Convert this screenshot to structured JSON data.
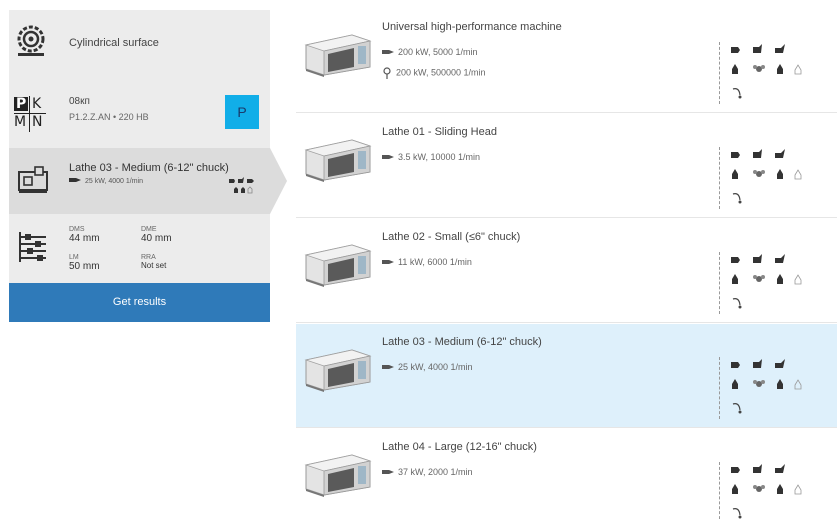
{
  "sidebar": {
    "operation": {
      "label": "Cylindrical surface",
      "icon": "cylinder-tool-icon"
    },
    "material": {
      "line1": "08кп",
      "line2": "P1.2.Z.AN • 220 HB",
      "badge": "P",
      "icon": "pkmn-material-icon",
      "badge_color": "#11aee8"
    },
    "machine": {
      "title": "Lathe 03 - Medium (6-12\" chuck)",
      "spec": "25 kW, 4000 1/min",
      "icon": "machine-icon"
    },
    "dimensions": {
      "icon": "dimensions-icon",
      "dms_label": "DMS",
      "dms_value": "44 mm",
      "dme_label": "DME",
      "dme_value": "40 mm",
      "lm_label": "LM",
      "lm_value": "50 mm",
      "rra_label": "RRA",
      "rra_value": "Not set"
    },
    "get_results_label": "Get results",
    "accent_color": "#2f7ab9"
  },
  "machines": [
    {
      "name": "Universal high-performance machine",
      "spec1": "200 kW, 5000 1/min",
      "spec2": "200 kW, 500000 1/min",
      "selected": false
    },
    {
      "name": "Lathe 01 - Sliding Head",
      "spec1": "3.5 kW, 10000 1/min",
      "spec2": "",
      "selected": false
    },
    {
      "name": "Lathe 02 - Small (≤6\" chuck)",
      "spec1": "11 kW, 6000 1/min",
      "spec2": "",
      "selected": false
    },
    {
      "name": "Lathe 03 - Medium (6-12\" chuck)",
      "spec1": "25 kW, 4000 1/min",
      "spec2": "",
      "selected": true
    },
    {
      "name": "Lathe 04 - Large (12-16\" chuck)",
      "spec1": "37 kW, 2000 1/min",
      "spec2": "",
      "selected": false
    }
  ],
  "selected_row_color": "#def0fb"
}
